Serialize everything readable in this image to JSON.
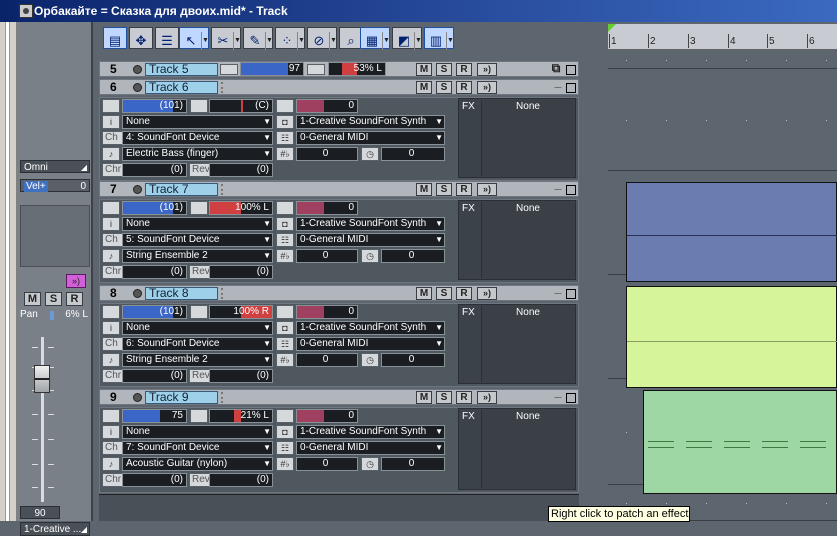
{
  "window": {
    "title": "Орбакайте = Сказка для двоих.mid* - Track"
  },
  "strip": {
    "input": "Omni",
    "velocity_label": "Vel+",
    "velocity_value": "0",
    "fx_icon": "fx-insert-icon",
    "m": "M",
    "s": "S",
    "r": "R",
    "pan_label": "Pan",
    "pan_value": "6% L",
    "pan_level": 0.06,
    "volume_value": "90",
    "volume_level": 0.71,
    "output": "1-Creative ..."
  },
  "toolbar": {
    "icons": [
      "track-view-icon",
      "move-icon",
      "clip-list-icon",
      "select-tool-icon",
      "scissors-icon",
      "draw-tool-icon",
      "pattern-tool-icon",
      "mute-tool-icon",
      "zoom-tool-icon",
      "grid-icon",
      "marker-icon",
      "layout-icon"
    ]
  },
  "buttons": {
    "m": "M",
    "s": "S",
    "r": "R",
    "io": "»)",
    "min": "_",
    "max": "□",
    "restore": "⧉"
  },
  "labels": {
    "ch": "Ch",
    "chr": "Chr",
    "rev": "Rev",
    "fx": "FX",
    "fx_none": "None"
  },
  "tracks": [
    {
      "num": "5",
      "name": "Track 5",
      "volume": "97",
      "volume_level": 0.76,
      "pan": "53% L",
      "pan_level": 0.53,
      "collapsed": true
    },
    {
      "num": "6",
      "name": "Track 6",
      "volume": "(101)",
      "volume_level": 0.79,
      "pan": "(C)",
      "pan_level": 0.0,
      "velocity": "0",
      "input": "None",
      "output": "1-Creative SoundFont Synth",
      "channel": "4: SoundFont Device",
      "bank": "0-General MIDI",
      "patch": "Electric Bass (finger)",
      "key": "0",
      "time": "0",
      "chorus": "(0)",
      "reverb": "(0)"
    },
    {
      "num": "7",
      "name": "Track 7",
      "volume": "(101)",
      "volume_level": 0.79,
      "pan": "100% L",
      "pan_level": 1.0,
      "velocity": "0",
      "input": "None",
      "output": "1-Creative SoundFont Synth",
      "channel": "5: SoundFont Device",
      "bank": "0-General MIDI",
      "patch": "String Ensemble 2",
      "key": "0",
      "time": "0",
      "chorus": "(0)",
      "reverb": "(0)"
    },
    {
      "num": "8",
      "name": "Track 8",
      "volume": "(101)",
      "volume_level": 0.79,
      "pan": "100% R",
      "pan_level": 1.0,
      "velocity": "0",
      "input": "None",
      "output": "1-Creative SoundFont Synth",
      "channel": "6: SoundFont Device",
      "bank": "0-General MIDI",
      "patch": "String Ensemble 2",
      "key": "0",
      "time": "0",
      "chorus": "(0)",
      "reverb": "(0)"
    },
    {
      "num": "9",
      "name": "Track 9",
      "volume": "75",
      "volume_level": 0.59,
      "pan": "21% L",
      "pan_level": 0.21,
      "velocity": "0",
      "input": "None",
      "output": "1-Creative SoundFont Synth",
      "channel": "7: SoundFont Device",
      "bank": "0-General MIDI",
      "patch": "Acoustic Guitar (nylon)",
      "key": "0",
      "time": "0",
      "chorus": "(0)",
      "reverb": "(0)"
    }
  ],
  "ruler": {
    "marks": [
      "1",
      "2",
      "3",
      "4",
      "5",
      "6"
    ]
  },
  "clip_colors": {
    "track7": "#6a7cb0",
    "track8": "#d6f59a",
    "track9": "#9fd7a4"
  },
  "tooltip": "Right click to patch an effect"
}
